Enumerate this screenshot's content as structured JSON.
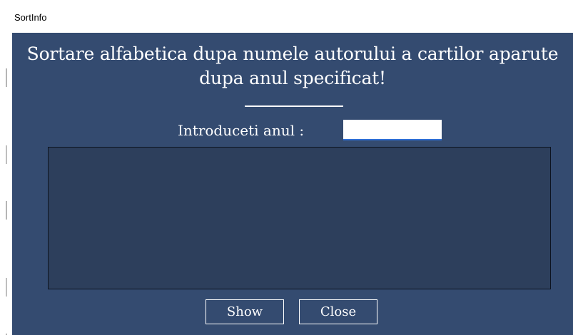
{
  "window": {
    "title": "SortInfo"
  },
  "main": {
    "heading": "Sortare alfabetica dupa numele autorului a cartilor aparute dupa anul specificat!",
    "year_label": "Introduceti anul :",
    "year_value": "",
    "results_items": []
  },
  "buttons": {
    "show_label": "Show",
    "close_label": "Close"
  },
  "colors": {
    "client_background": "#344b70",
    "results_panel_background": "#2d3f5c",
    "text": "#ffffff",
    "input_focus_underline": "#2f6fd6"
  }
}
